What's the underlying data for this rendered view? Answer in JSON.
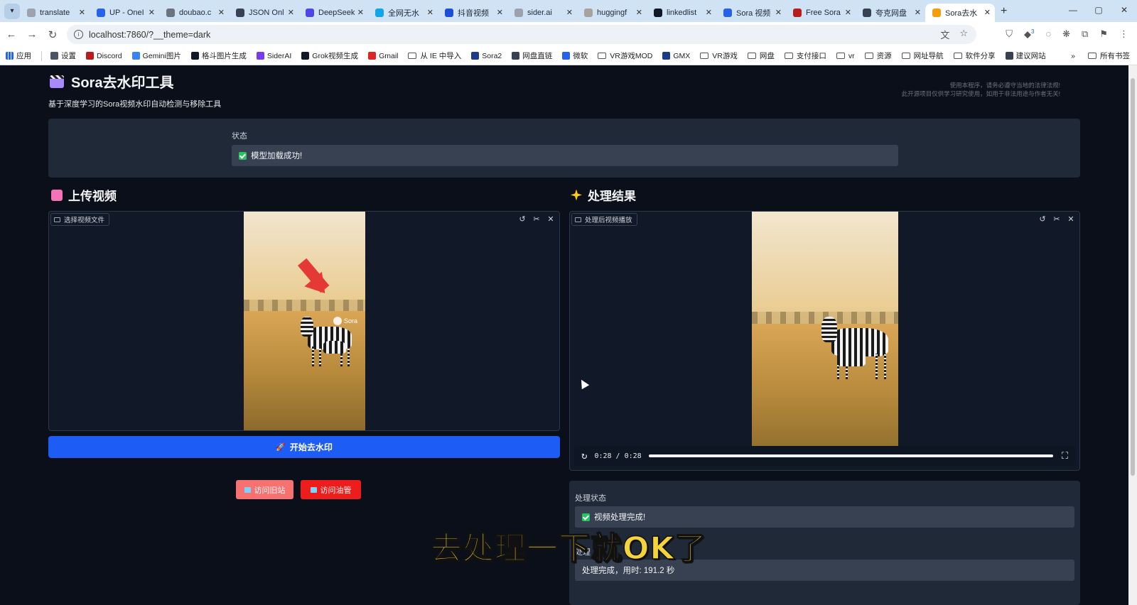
{
  "browser": {
    "tabs": [
      {
        "title": "translate",
        "color": "#9ca3af"
      },
      {
        "title": "UP - OneI",
        "color": "#2563eb"
      },
      {
        "title": "doubao.c",
        "color": "#6b7280"
      },
      {
        "title": "JSON Onl",
        "color": "#374151"
      },
      {
        "title": "DeepSeek",
        "color": "#4f46e5"
      },
      {
        "title": "全网无水",
        "color": "#0ea5e9"
      },
      {
        "title": "抖音视频",
        "color": "#1d4ed8"
      },
      {
        "title": "sider.ai",
        "color": "#9ca3af"
      },
      {
        "title": "huggingf",
        "color": "#a8a29e"
      },
      {
        "title": "linkedlist",
        "color": "#111827"
      },
      {
        "title": "Sora 视频",
        "color": "#2563eb"
      },
      {
        "title": "Free Sora",
        "color": "#b91c1c"
      },
      {
        "title": "夸克网盘",
        "color": "#374151"
      },
      {
        "title": "Sora去水",
        "color": "#f59e0b",
        "active": true
      }
    ],
    "url": "localhost:7860/?__theme=dark",
    "bookmarks": [
      {
        "label": "应用",
        "kind": "grid",
        "color": "#2563eb"
      },
      {
        "label": "设置",
        "kind": "icon",
        "color": "#4b5563"
      },
      {
        "label": "Discord",
        "kind": "icon",
        "color": "#b91c1c"
      },
      {
        "label": "Gemini图片",
        "kind": "icon",
        "color": "#3b82f6"
      },
      {
        "label": "格斗图片生成",
        "kind": "icon",
        "color": "#111827"
      },
      {
        "label": "SiderAI",
        "kind": "icon",
        "color": "#7c3aed"
      },
      {
        "label": "Grok视频生成",
        "kind": "icon",
        "color": "#111827"
      },
      {
        "label": "Gmail",
        "kind": "icon",
        "color": "#dc2626"
      },
      {
        "label": "从 IE 中导入",
        "kind": "folder"
      },
      {
        "label": "Sora2",
        "kind": "icon",
        "color": "#1e3a8a"
      },
      {
        "label": "网盘直链",
        "kind": "icon",
        "color": "#374151"
      },
      {
        "label": "微软",
        "kind": "icon",
        "color": "#2563eb"
      },
      {
        "label": "VR游戏MOD",
        "kind": "folder"
      },
      {
        "label": "GMX",
        "kind": "icon",
        "color": "#1e3a8a"
      },
      {
        "label": "VR游戏",
        "kind": "folder"
      },
      {
        "label": "网盘",
        "kind": "folder"
      },
      {
        "label": "支付接口",
        "kind": "folder"
      },
      {
        "label": "vr",
        "kind": "folder"
      },
      {
        "label": "资源",
        "kind": "folder"
      },
      {
        "label": "网址导航",
        "kind": "folder"
      },
      {
        "label": "软件分享",
        "kind": "folder"
      },
      {
        "label": "建议网站",
        "kind": "icon",
        "color": "#374151"
      }
    ],
    "all_bookmarks": "所有书签",
    "ext_badge": "3"
  },
  "app": {
    "title": "Sora去水印工具",
    "subtitle": "基于深度学习的Sora视频水印自动检测与移除工具",
    "legal_line1": "使用本程序，请务必遵守当地的法律法规!",
    "legal_line2": "此开源项目仅供学习研究使用，如用于非法用途与作者无关!",
    "status_label": "状态",
    "status_value": "模型加载成功!"
  },
  "upload": {
    "section_title": "上传视频",
    "panel_label": "选择视频文件",
    "watermark_text": "Sora",
    "start_button": "开始去水印",
    "link_buttons": [
      {
        "label": "访问旧站",
        "color": "#f87171"
      },
      {
        "label": "访问油管",
        "color": "#ef1c1c"
      }
    ]
  },
  "result": {
    "section_title": "处理结果",
    "panel_label": "处理后视频播放",
    "time": "0:28 / 0:28",
    "progress": 1.0,
    "process_status_label": "处理状态",
    "process_status_value": "视频处理完成!",
    "result_label": "处理",
    "result_value": "处理完成，用时: 191.2 秒"
  },
  "overlay": {
    "subtitle_caption": "去处理一下就OK了"
  },
  "colors": {
    "accent": "#1d5cf5",
    "panel": "#1f2937",
    "page_bg": "#0b0f19"
  }
}
